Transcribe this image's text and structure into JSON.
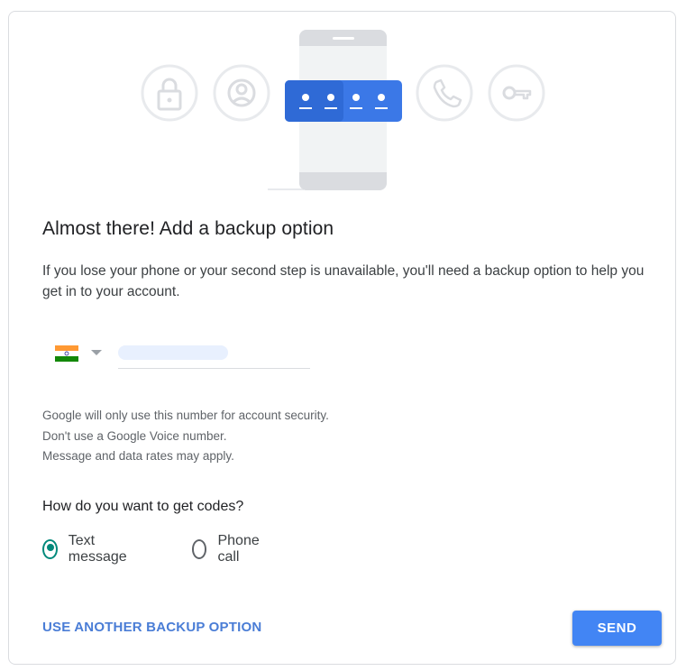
{
  "colors": {
    "accent_blue": "#4285f4",
    "link_blue": "#4a7dd6",
    "radio_selected": "#00897b",
    "illustration_circle": "#e8eaed",
    "illustration_card": "#3b78e7"
  },
  "illustration": {
    "left_icons": [
      "lock-icon",
      "account-circle-icon"
    ],
    "right_icons": [
      "phone-icon",
      "key-icon"
    ],
    "center": "phone-with-password-card"
  },
  "heading": "Almost there! Add a backup option",
  "description": "If you lose your phone or your second step is unavailable, you'll need a backup option to help you get in to your account.",
  "phone": {
    "country_flag": "india-flag-icon",
    "country_dropdown_icon": "dropdown-caret-icon",
    "number_value": ""
  },
  "notes": [
    "Google will only use this number for account security.",
    "Don't use a Google Voice number.",
    "Message and data rates may apply."
  ],
  "codes_question": "How do you want to get codes?",
  "options": [
    {
      "label": "Text message",
      "selected": true
    },
    {
      "label": "Phone call",
      "selected": false
    }
  ],
  "actions": {
    "alternate_link": "USE ANOTHER BACKUP OPTION",
    "send_button": "SEND"
  }
}
